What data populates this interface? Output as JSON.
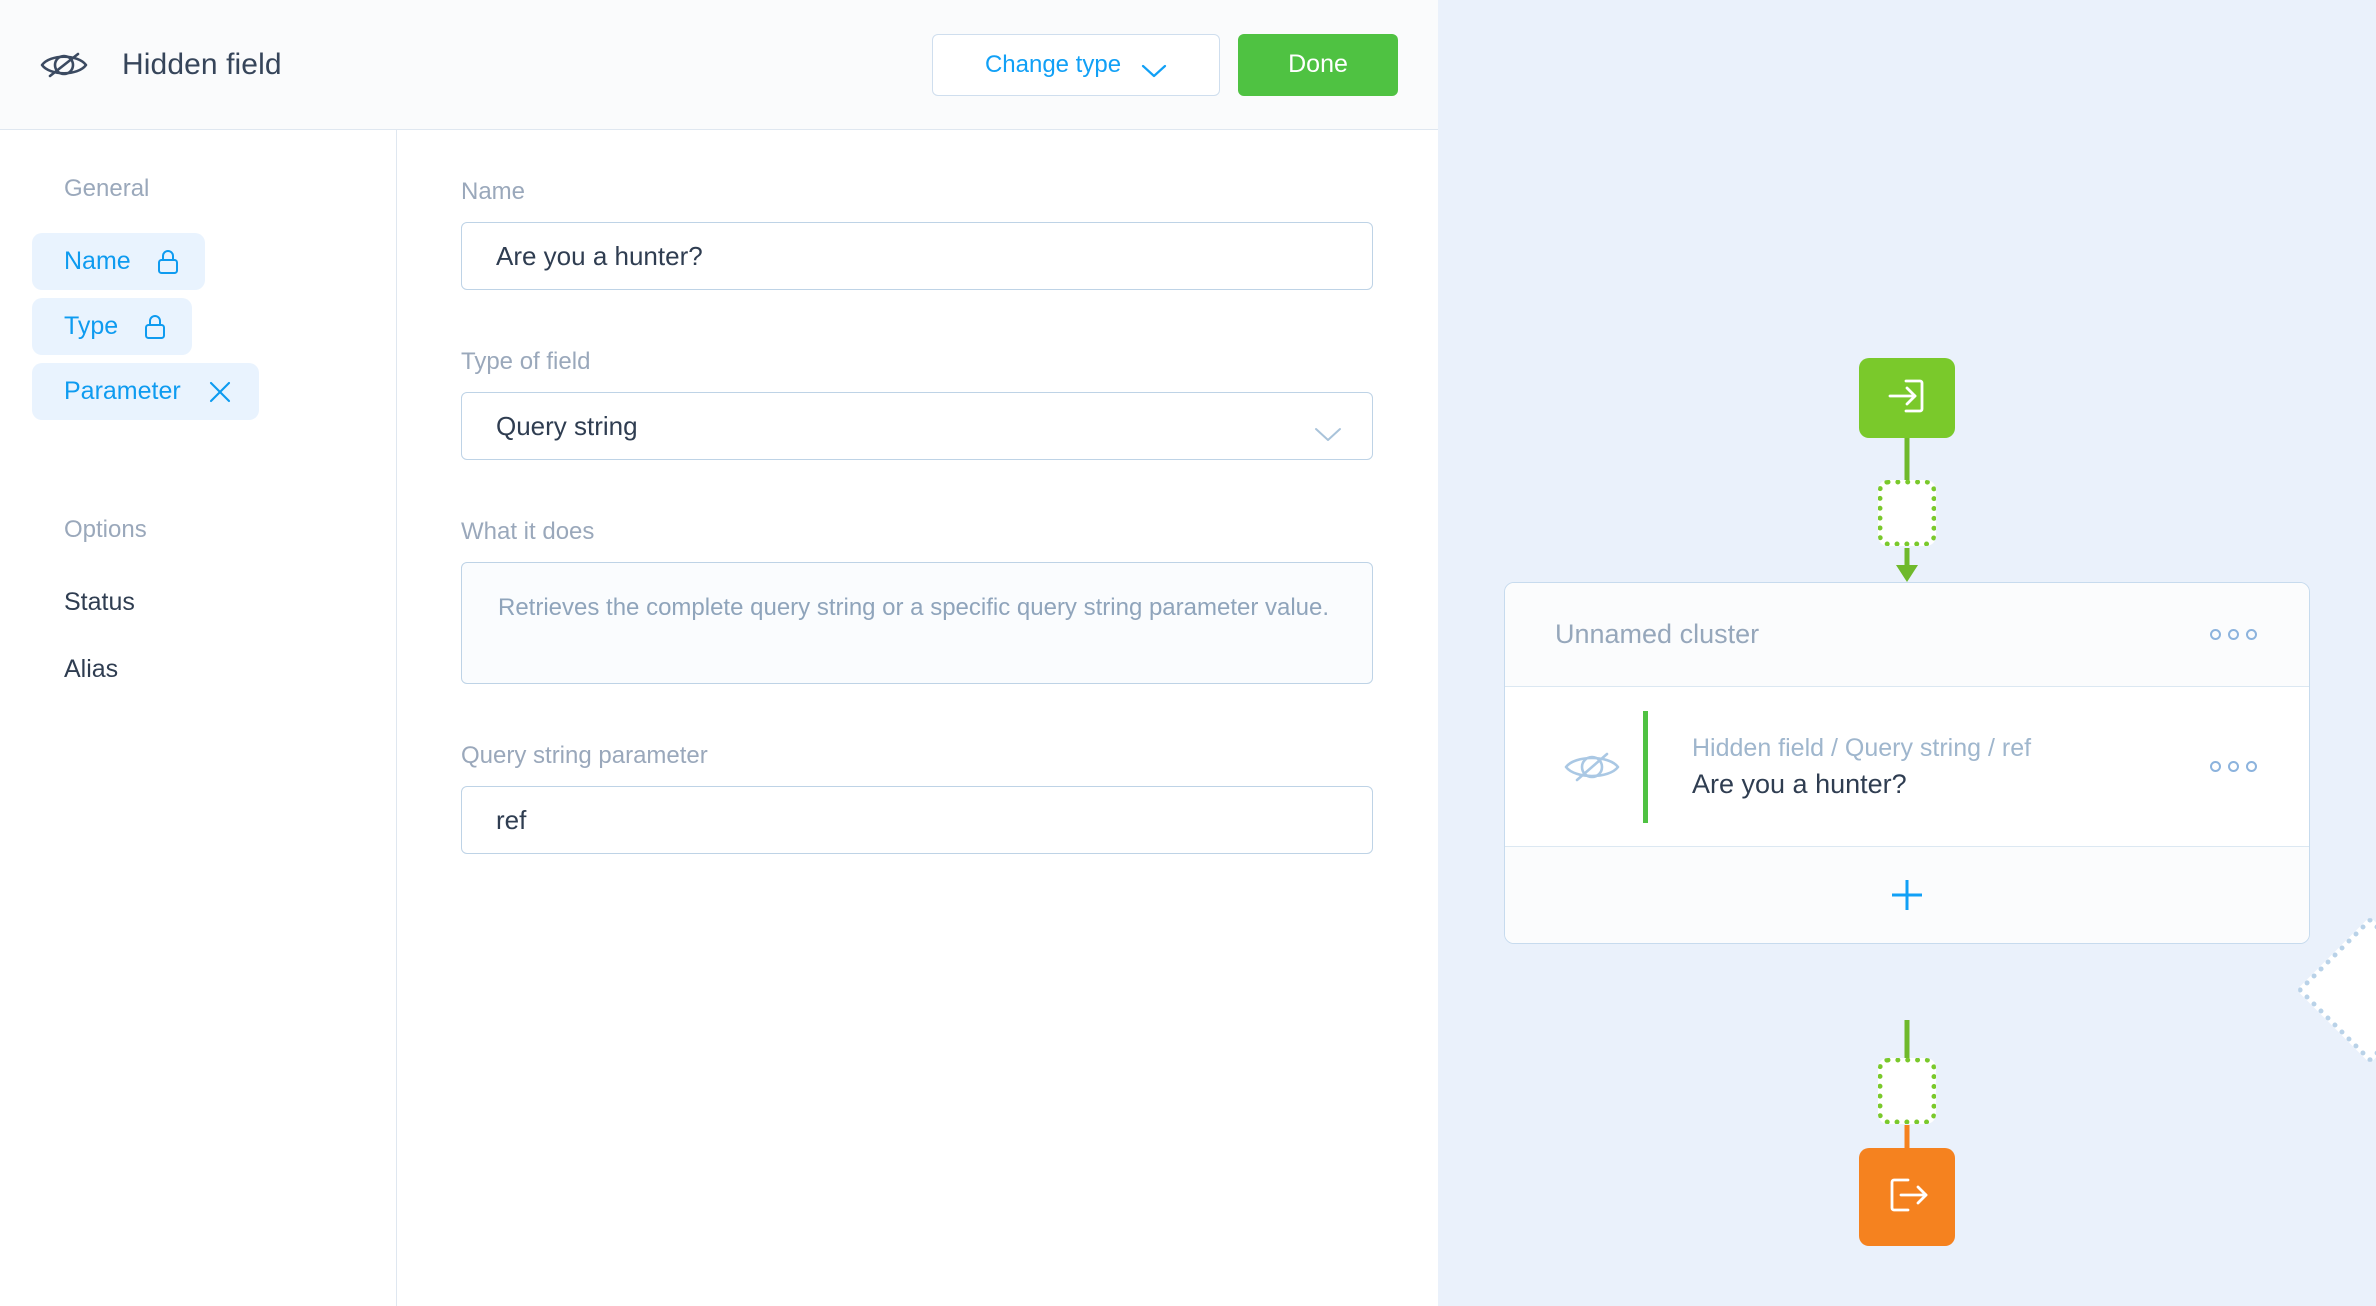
{
  "header": {
    "icon": "eye-slash-icon",
    "title": "Hidden field",
    "change_type_label": "Change type",
    "change_type_icon": "chevron-down-icon",
    "done_label": "Done"
  },
  "sidebar": {
    "groups": [
      {
        "title": "General",
        "items": [
          {
            "label": "Name",
            "icon": "lock-icon",
            "active": true
          },
          {
            "label": "Type",
            "icon": "lock-icon",
            "active": true
          },
          {
            "label": "Parameter",
            "icon": "close-icon",
            "active": true
          }
        ]
      },
      {
        "title": "Options",
        "items": [
          {
            "label": "Status",
            "icon": "",
            "active": false
          },
          {
            "label": "Alias",
            "icon": "",
            "active": false
          }
        ]
      }
    ]
  },
  "form": {
    "name": {
      "label": "Name",
      "value": "Are you a hunter?"
    },
    "type_of_field": {
      "label": "Type of field",
      "value": "Query string",
      "icon": "chevron-down-icon"
    },
    "what_it_does": {
      "label": "What it does",
      "value": "Retrieves the complete query string or a specific query string parameter value."
    },
    "query_string_parameter": {
      "label": "Query string parameter",
      "value": "ref"
    }
  },
  "flow": {
    "start_node": {
      "icon": "enter-arrow-icon",
      "color": "#7ac92b"
    },
    "end_node": {
      "icon": "exit-arrow-icon",
      "color": "#f5821f"
    },
    "cluster": {
      "title": "Unnamed cluster",
      "menu_icon": "three-dots-icon",
      "rows": [
        {
          "icon": "eye-slash-icon",
          "subtitle": "Hidden field / Query string / ref",
          "title": "Are you a hunter?",
          "menu_icon": "three-dots-icon",
          "accent": "#4fc242"
        }
      ],
      "add_label": "+",
      "add_icon": "plus-icon"
    }
  },
  "colors": {
    "accent_blue": "#0e9bf0",
    "done_green": "#4fc242",
    "flow_green": "#7ac92b",
    "flow_orange": "#f5821f",
    "panel_bg": "#eaf1fb",
    "text_dark": "#2f3d51",
    "text_muted": "#9aa8bb"
  }
}
